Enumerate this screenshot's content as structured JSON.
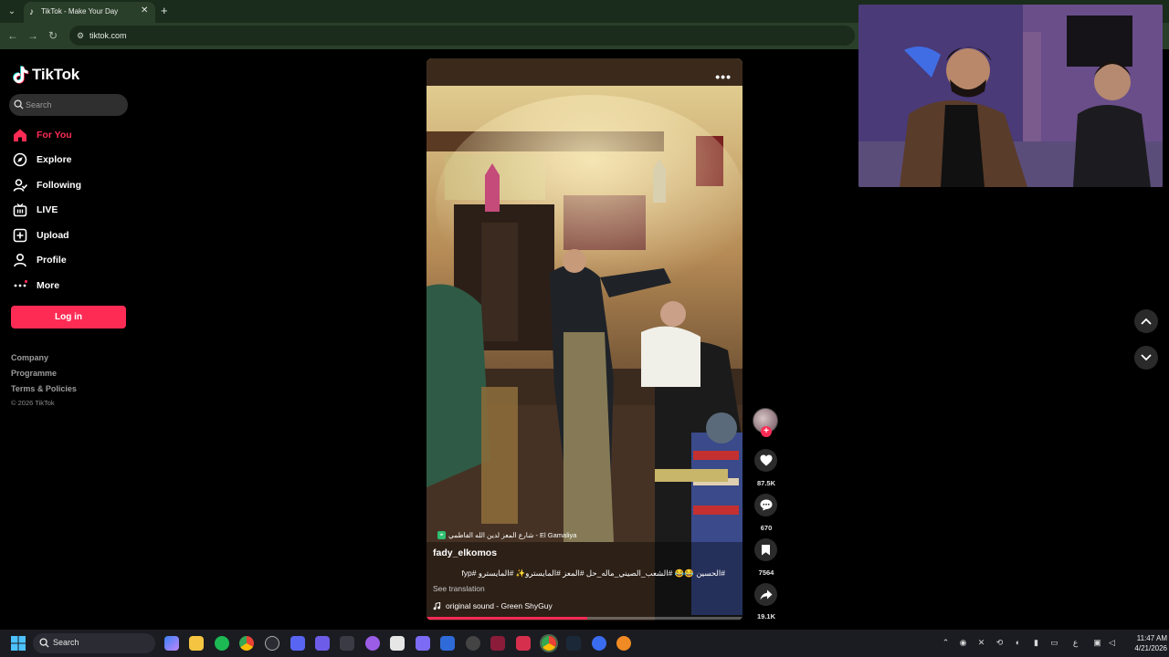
{
  "browser": {
    "tab_title": "TikTok - Make Your Day",
    "url": "tiktok.com"
  },
  "sidebar": {
    "logo_text": "TikTok",
    "search_placeholder": "Search",
    "nav": [
      {
        "label": "For You",
        "icon": "home-icon",
        "active": true
      },
      {
        "label": "Explore",
        "icon": "compass-icon"
      },
      {
        "label": "Following",
        "icon": "following-icon"
      },
      {
        "label": "LIVE",
        "icon": "live-icon"
      },
      {
        "label": "Upload",
        "icon": "upload-icon"
      },
      {
        "label": "Profile",
        "icon": "profile-icon"
      },
      {
        "label": "More",
        "icon": "more-icon"
      }
    ],
    "login_label": "Log in",
    "footer_links": [
      "Company",
      "Programme",
      "Terms & Policies"
    ],
    "copyright": "© 2026 TikTok"
  },
  "video": {
    "location": "شارع المعز لدين الله الفاطمي - El Gamaliya",
    "username": "fady_elkomos",
    "caption": "#الحسين 😂😂 #الشعب_الصيني_ماله_حل #المعز #المايسترو✨ #المايسترو #fyp",
    "see_translation": "See translation",
    "sound": "original sound - Green ShyGuy",
    "progress": 0.51
  },
  "actions": {
    "likes": "87.5K",
    "comments": "670",
    "saves": "7564",
    "shares": "19.1K"
  },
  "taskbar": {
    "search_label": "Search",
    "time": "11:47 AM",
    "date": "4/21/2026"
  },
  "colors": {
    "accent": "#fe2c55",
    "browser_frame": "#2a3f2a",
    "taskbar": "#1b1c22"
  }
}
